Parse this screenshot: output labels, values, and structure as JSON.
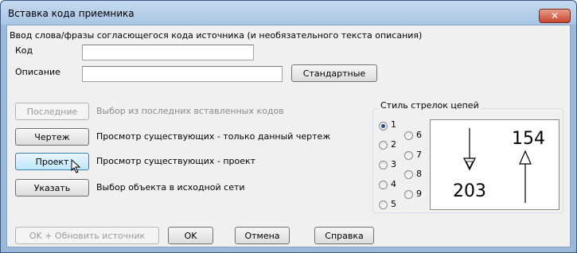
{
  "window": {
    "title": "Вставка кода приемника",
    "close_label": "✕"
  },
  "intro_text": "Ввод слова/фразы согласющегося кода источника (и необязательного текста описания)",
  "fields": {
    "code_label": "Код",
    "code_value": "",
    "description_label": "Описание",
    "description_value": "",
    "standard_button": "Стандартные"
  },
  "actions": [
    {
      "button": "Последние",
      "text": "Выбор из последних вставленных кодов",
      "enabled": false
    },
    {
      "button": "Чертеж",
      "text": "Просмотр существующих - только данный чертеж",
      "enabled": true
    },
    {
      "button": "Проект",
      "text": "Просмотр существующих - проект",
      "enabled": true
    },
    {
      "button": "Указать",
      "text": "Выбор объекта в исходной сети",
      "enabled": true
    }
  ],
  "arrow_style": {
    "title": "Стиль стрелок цепей",
    "options": [
      "1",
      "2",
      "3",
      "4",
      "5",
      "6",
      "7",
      "8",
      "9"
    ],
    "selected": "1",
    "preview": {
      "left_label": "203",
      "right_label": "154"
    }
  },
  "footer": {
    "ok_update": "OK + Обновить источник",
    "ok": "OK",
    "cancel": "Отмена",
    "help": "Справка"
  }
}
